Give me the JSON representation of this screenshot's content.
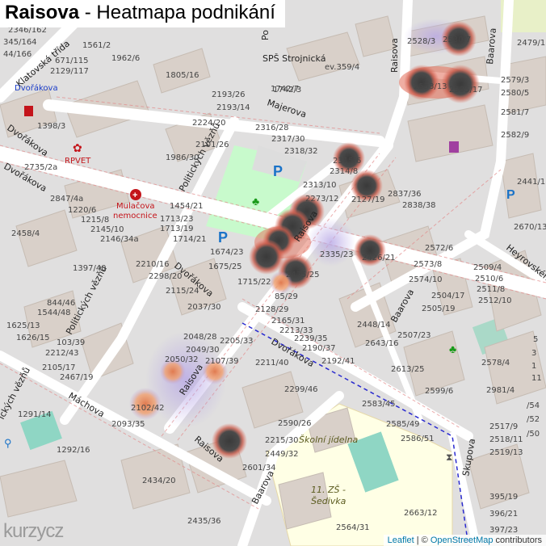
{
  "title": {
    "bold": "Raisova",
    "rest": " - Heatmapa podnikání"
  },
  "attribution": {
    "leaflet": "Leaflet",
    "sep": " | © ",
    "osm": "OpenStreetMap",
    "suffix": " contributors"
  },
  "logo": {
    "text": "kurzy",
    "cz": "cz"
  },
  "streets": {
    "raisova_main": "Raisova",
    "raisova_bottom": "Raisova",
    "raisova_top": "Raisova",
    "raisova_mid": "Raisova",
    "majerova": "Majerova",
    "dvorakova_left": "Dvořákova",
    "dvorakova_mid": "Dvořákova",
    "dvorakova_right": "Dvořákova",
    "dvorakova_top": "Dvořákova",
    "politickych_top": "Politických vězňů",
    "politickych_mid": "Politických vězňů",
    "politickych_bottom": "ických vězňů",
    "klatovska": "Klatovská třída",
    "baarova_top": "Baarova",
    "baarova_mid": "Baarova",
    "baarova_bottom": "Baarova",
    "machova": "Máchova",
    "skupova": "Skupova",
    "heyrovskeho": "Heyrovského",
    "po": "Po"
  },
  "places": {
    "sps": "SPŠ Strojnická",
    "rpvet": "RPVET",
    "nemocnice1": "Mulačova",
    "nemocnice2": "nemocnice",
    "skolni_jidelna": "Školní jídelna",
    "zs1": "11. ZŠ -",
    "zs2": "Šedivka",
    "dvorakova_poi": "Dvořákova"
  },
  "house_numbers": [
    "2346/162",
    "345/164",
    "44/166",
    "671/115",
    "2129/117",
    "1561/2",
    "1962/6",
    "1805/16",
    "1742/7",
    "ev.359/4",
    "1742/3",
    "2193/26",
    "2193/14",
    "2224/20",
    "2101/26",
    "1986/30",
    "2316/28",
    "2317/30",
    "2318/32",
    "2315/6",
    "2314/8",
    "2313/10",
    "2273/12",
    "2127/19",
    "2837/36",
    "2838/38",
    "2335/23",
    "2426/21",
    "2475/25",
    "85/29",
    "1715/22",
    "1675/25",
    "1674/23",
    "1714/21",
    "1713/19",
    "1713/23",
    "1454/21",
    "1398/3",
    "2735/2a",
    "2847/4a",
    "1220/6",
    "1215/8",
    "2145/10",
    "2146/34a",
    "2458/4",
    "1397/40",
    "2210/16",
    "2298/20",
    "2115/24",
    "2037/30",
    "844/46",
    "1544/48",
    "1625/13",
    "1626/15",
    "103/39",
    "2212/43",
    "2105/17",
    "2467/19",
    "2048/28",
    "2049/30",
    "2050/32",
    "2205/33",
    "2107/39",
    "2128/29",
    "2165/31",
    "2213/33",
    "2239/35",
    "2190/37",
    "2192/41",
    "2211/40",
    "2448/14",
    "2643/16",
    "2528/3",
    "2530/7",
    "2533/13",
    "2535/17",
    "2479/1",
    "2579/3",
    "2580/5",
    "2581/7",
    "2582/9",
    "2441/11",
    "2670/13",
    "2572/6",
    "2573/8",
    "2574/10",
    "2504/17",
    "2505/19",
    "2507/23",
    "2509/4",
    "2510/6",
    "2511/8",
    "2512/10",
    "2613/25",
    "2578/4",
    "2599/6",
    "2981/4",
    "2583/45",
    "2585/49",
    "2586/51",
    "2299/46",
    "2590/26",
    "2215/30",
    "2449/32",
    "2601/34",
    "1291/14",
    "1292/16",
    "2093/35",
    "2102/42",
    "2434/20",
    "2435/36",
    "2663/12",
    "2564/31",
    "395/19",
    "396/21",
    "397/23",
    "2519/13",
    "2518/11",
    "2517/9",
    "/50",
    "/52",
    "/54",
    "11",
    "1",
    "3",
    "5",
    "/11"
  ],
  "heat_points": [
    {
      "id": "h1",
      "label": "2530/7",
      "intensity": 0.9
    },
    {
      "id": "h2",
      "label": "2533/13",
      "intensity": 0.95
    },
    {
      "id": "h3",
      "label": "2535/17",
      "intensity": 0.95
    },
    {
      "id": "h4",
      "label": "2315/6",
      "intensity": 0.9
    },
    {
      "id": "h5",
      "label": "2313/10",
      "intensity": 0.9
    },
    {
      "id": "h6",
      "label": "2273/12",
      "intensity": 0.9
    },
    {
      "id": "h7",
      "label": "2426/21",
      "intensity": 0.9
    },
    {
      "id": "h8",
      "label": "2475/25",
      "intensity": 0.9
    },
    {
      "id": "h9",
      "label": "1675/25",
      "intensity": 0.9
    },
    {
      "id": "h10",
      "label": "85/29",
      "intensity": 0.6
    },
    {
      "id": "h11",
      "label": "2050/32",
      "intensity": 0.6
    },
    {
      "id": "h12",
      "label": "2107/39",
      "intensity": 0.6
    },
    {
      "id": "h13",
      "label": "2102/42",
      "intensity": 0.7
    },
    {
      "id": "h14",
      "label": "2449/32",
      "intensity": 0.9
    }
  ],
  "colors": {
    "water": "#aad3df",
    "school": "#ffffe5",
    "park": "#c8facc",
    "road": "#ffffff",
    "building": "#d9d0c9",
    "heat": "#d04a32",
    "dark": "#3a3a3a"
  }
}
